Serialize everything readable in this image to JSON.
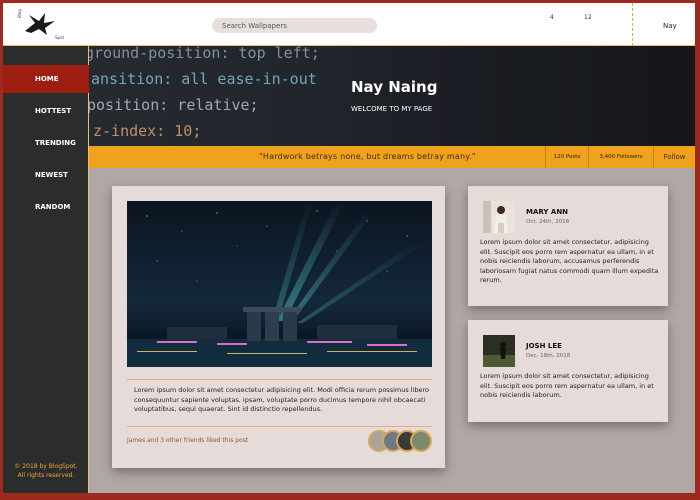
{
  "header": {
    "logo_text_top": "Blog",
    "logo_text_bottom": "Spot",
    "search_placeholder": "Search Wallpapers",
    "notifications": [
      "4",
      "12"
    ],
    "username": "Nay"
  },
  "sidebar": {
    "items": [
      {
        "label": "HOME",
        "active": true
      },
      {
        "label": "HOTTEST"
      },
      {
        "label": "TRENDING"
      },
      {
        "label": "NEWEST"
      },
      {
        "label": "RANDOM"
      }
    ],
    "footer_line1": "© 2018 by BlogSpot.",
    "footer_line2": "All rights reserved."
  },
  "banner": {
    "code_lines": [
      "ground-position: top left;",
      "ansition: all ease-in-out",
      "position: relative;",
      "z-index: 10;"
    ],
    "title": "Nay Naing",
    "subtitle": "WELCOME TO MY PAGE"
  },
  "strip": {
    "quote": "\"Hardwork betrays none, but dreams betray many.\"",
    "posts": "120 Posts",
    "followers": "3,400 Followers",
    "follow_label": "Follow"
  },
  "post": {
    "text": "Lorem ipsum dolor sit amet consectetur adipisicing elit. Modi officia rerum possimus libero consequuntur sapiente voluptas, ipsam, voluptate porro ducimus tempore nihil obcaecati voluptatibus, sequi quaerat. Sint id distinctio repellendus.",
    "liked_text": "James and 3 other friends liked this post"
  },
  "profiles": [
    {
      "name": "MARY ANN",
      "date": "Oct. 24th, 2018",
      "text": "Lorem ipsum dolor sit amet consectetur, adipisicing elit. Suscipit eos porro rem aspernatur ea ullam, in et nobis reiciendis laborum, accusamus perferendis laboriosam fugiat natus commodi quam illum expedita rerum."
    },
    {
      "name": "JOSH LEE",
      "date": "Dec. 18th, 2018",
      "text": "Lorem ipsum dolor sit amet consectetur, adipisicing elit. Suscipit eos porro rem aspernatur ea ullam, in et nobis reiciendis laborum."
    }
  ],
  "colors": {
    "accent_orange": "#f0a21d",
    "active_red": "#9e1f12",
    "sidebar_dark": "#2b2d2c"
  }
}
